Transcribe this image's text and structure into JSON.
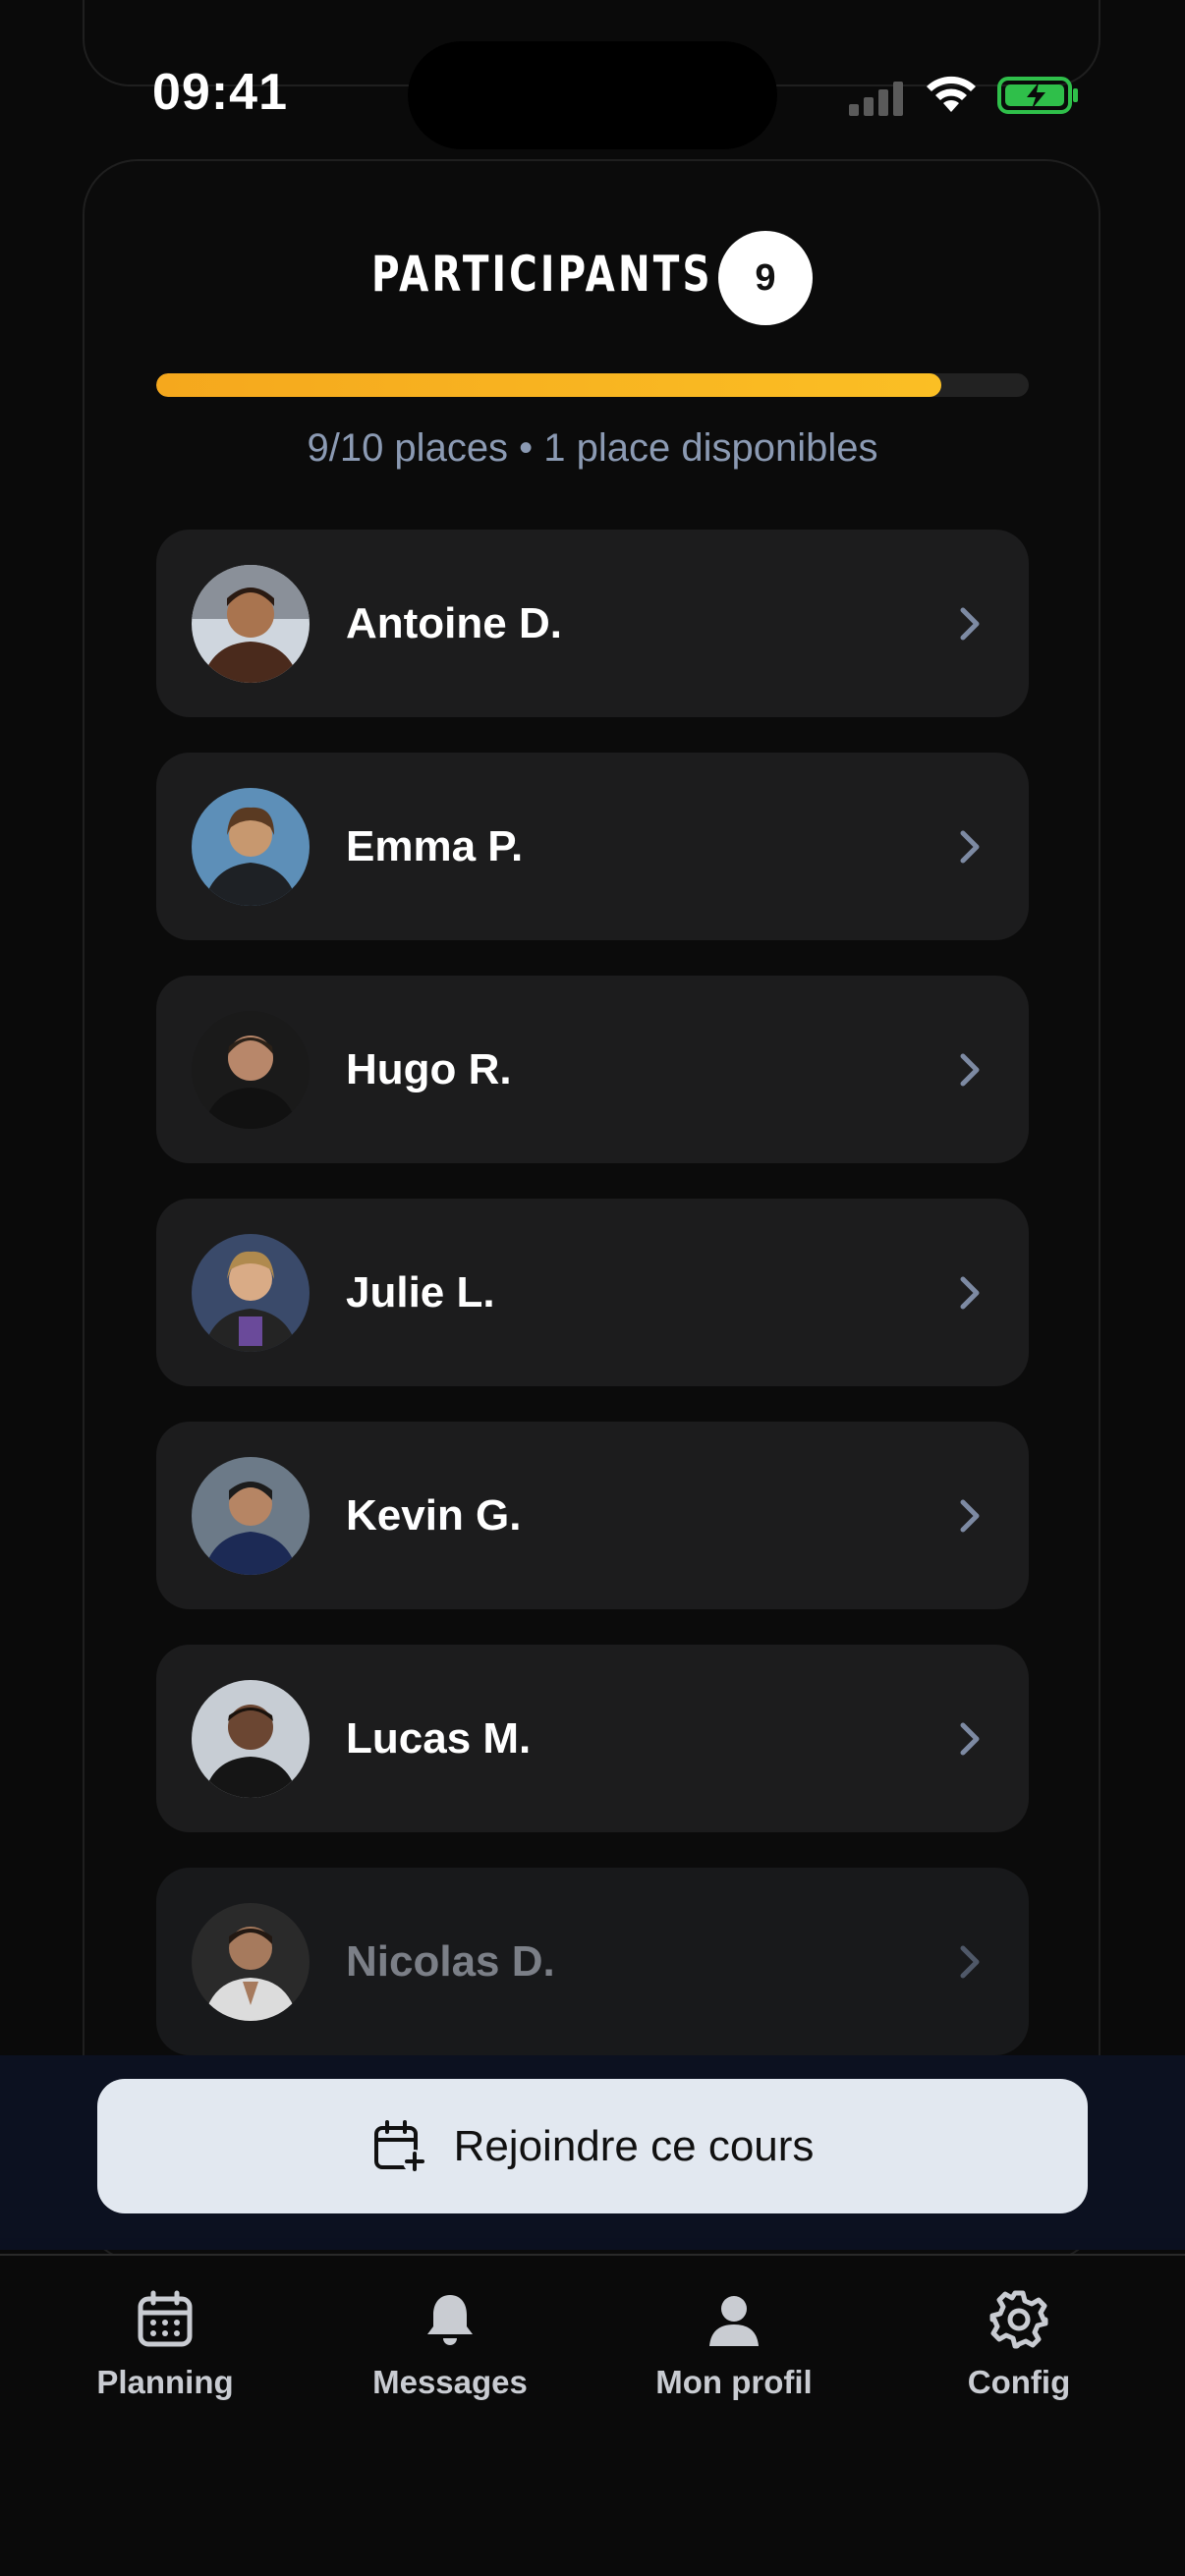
{
  "status_bar": {
    "time": "09:41"
  },
  "header": {
    "title": "PARTICIPANTS",
    "count": "9"
  },
  "capacity": {
    "text": "9/10 places • 1 place disponibles",
    "filled_fraction": 0.9
  },
  "participants": [
    {
      "name": "Antoine D.",
      "avatar": "avatar-photo"
    },
    {
      "name": "Emma P.",
      "avatar": "avatar-photo"
    },
    {
      "name": "Hugo R.",
      "avatar": "avatar-photo"
    },
    {
      "name": "Julie L.",
      "avatar": "avatar-photo"
    },
    {
      "name": "Kevin G.",
      "avatar": "avatar-photo"
    },
    {
      "name": "Lucas M.",
      "avatar": "avatar-photo"
    },
    {
      "name": "Nicolas D.",
      "avatar": "avatar-photo"
    }
  ],
  "join_button": {
    "label": "Rejoindre ce cours",
    "icon": "calendar-plus-icon"
  },
  "tabs": [
    {
      "label": "Planning",
      "icon": "calendar-icon"
    },
    {
      "label": "Messages",
      "icon": "bell-icon"
    },
    {
      "label": "Mon profil",
      "icon": "person-icon"
    },
    {
      "label": "Config",
      "icon": "gear-icon"
    }
  ],
  "colors": {
    "background": "#0a0a0a",
    "card": "#1c1c1d",
    "accent": "#fbbf24",
    "muted_text": "#8b9ab3",
    "button_bg": "#e2e8f0"
  }
}
